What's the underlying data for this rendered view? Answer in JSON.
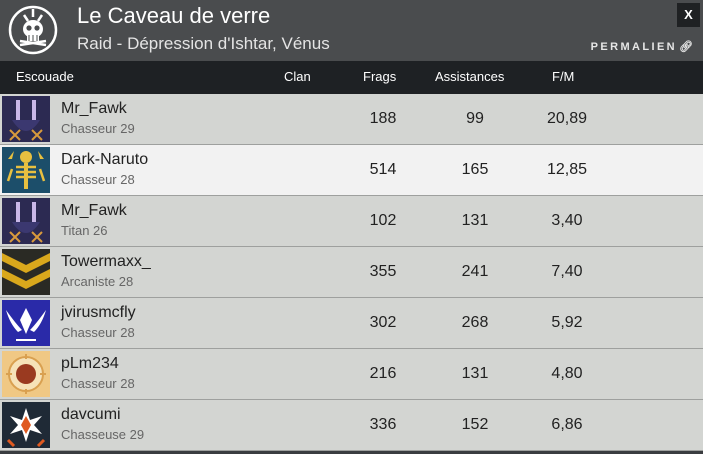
{
  "header": {
    "title": "Le Caveau de verre",
    "subtitle": "Raid - Dépression d'Ishtar, Vénus",
    "close_label": "X",
    "permalink_label": "PERMALIEN",
    "permalink_icon": "link-icon",
    "emblem_icon": "raid-skull-emblem-icon"
  },
  "columns": {
    "squad": "Escouade",
    "clan": "Clan",
    "frags": "Frags",
    "assists": "Assistances",
    "fm": "F/M"
  },
  "rows": [
    {
      "name": "Mr_Fawk",
      "class": "Chasseur 29",
      "clan": "",
      "frags": "188",
      "assists": "99",
      "fm": "20,89",
      "emblem": "rabbit-emblem-icon"
    },
    {
      "name": "Dark-Naruto",
      "class": "Chasseur 28",
      "clan": "",
      "frags": "514",
      "assists": "165",
      "fm": "12,85",
      "emblem": "skeleton-emblem-icon"
    },
    {
      "name": "Mr_Fawk",
      "class": "Titan 26",
      "clan": "",
      "frags": "102",
      "assists": "131",
      "fm": "3,40",
      "emblem": "rabbit-emblem-icon"
    },
    {
      "name": "Towermaxx_",
      "class": "Arcaniste 28",
      "clan": "",
      "frags": "355",
      "assists": "241",
      "fm": "7,40",
      "emblem": "chevron-emblem-icon"
    },
    {
      "name": "jvirusmcfly",
      "class": "Chasseur 28",
      "clan": "",
      "frags": "302",
      "assists": "268",
      "fm": "5,92",
      "emblem": "winged-emblem-icon"
    },
    {
      "name": "pLm234",
      "class": "Chasseur 28",
      "clan": "",
      "frags": "216",
      "assists": "131",
      "fm": "4,80",
      "emblem": "sun-emblem-icon"
    },
    {
      "name": "davcumi",
      "class": "Chasseuse 29",
      "clan": "",
      "frags": "336",
      "assists": "152",
      "fm": "6,86",
      "emblem": "star-emblem-icon"
    }
  ],
  "colors": {
    "header_bg": "#4a4c4e",
    "column_header_bg": "#1e2124",
    "row_bg": "#d3d5d2",
    "row_highlight_bg": "#f2f2f2"
  }
}
